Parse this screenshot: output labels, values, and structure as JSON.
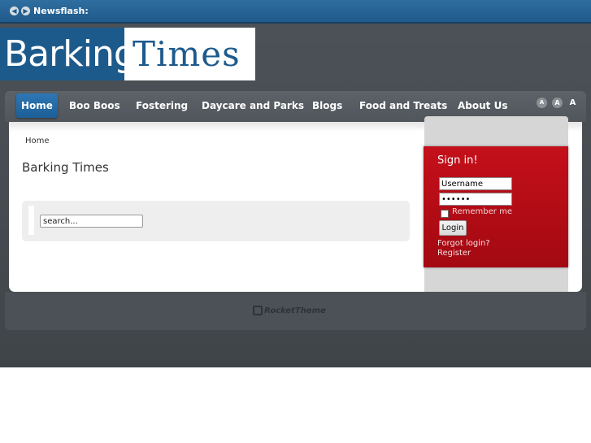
{
  "newsflash": {
    "label": "Newsflash:",
    "prev_icon": "chevron-left-icon",
    "next_icon": "chevron-right-icon"
  },
  "logo": {
    "left_text": "Barking",
    "right_text": "Times",
    "left_bg": "#1d5a8c",
    "right_color": "#1d5a8c"
  },
  "nav": {
    "items": [
      {
        "label": "Home",
        "active": true
      },
      {
        "label": "Boo Boos"
      },
      {
        "label": "Fostering"
      },
      {
        "label": "Daycare and Parks"
      },
      {
        "label": "Blogs"
      },
      {
        "label": "Food and Treats"
      },
      {
        "label": "About Us"
      }
    ],
    "font_sizes": [
      "A",
      "A",
      "A"
    ],
    "active_color": "#2d77b5"
  },
  "main": {
    "breadcrumb": "Home",
    "title": "Barking Times",
    "search_value": "search..."
  },
  "login": {
    "title": "Sign in!",
    "username_value": "Username",
    "password_value": "••••••",
    "remember_label": "Remember me",
    "remember_checked": false,
    "button_label": "Login",
    "forgot_link": "Forgot login?",
    "register_link": "Register",
    "panel_color": "#b50d16"
  },
  "footer": {
    "logo_text": "RocketTheme"
  }
}
